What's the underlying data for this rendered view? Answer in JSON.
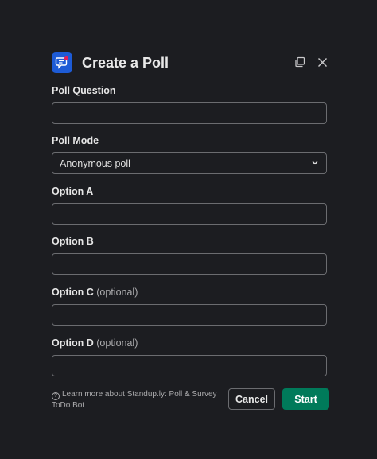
{
  "modal": {
    "title": "Create a Poll",
    "colors": {
      "accent": "#007a5a",
      "app_icon_bg": "#1d5bd6",
      "background": "#1c1d21"
    }
  },
  "fields": {
    "question": {
      "label": "Poll Question",
      "value": "",
      "placeholder": ""
    },
    "mode": {
      "label": "Poll Mode",
      "selected": "Anonymous poll"
    },
    "option_a": {
      "label": "Option A",
      "value": "",
      "placeholder": ""
    },
    "option_b": {
      "label": "Option B",
      "value": "",
      "placeholder": ""
    },
    "option_c": {
      "label": "Option C",
      "optional": "(optional)",
      "value": "",
      "placeholder": ""
    },
    "option_d": {
      "label": "Option D",
      "optional": "(optional)",
      "value": "",
      "placeholder": ""
    }
  },
  "footer": {
    "help_text": "Learn more about Standup.ly: Poll & Survey ToDo Bot",
    "cancel_label": "Cancel",
    "start_label": "Start"
  },
  "icons": {
    "app": "poll-app-icon",
    "expand": "expand-window-icon",
    "close": "close-icon",
    "dropdown": "chevron-down-icon",
    "help": "question-circle-icon"
  }
}
